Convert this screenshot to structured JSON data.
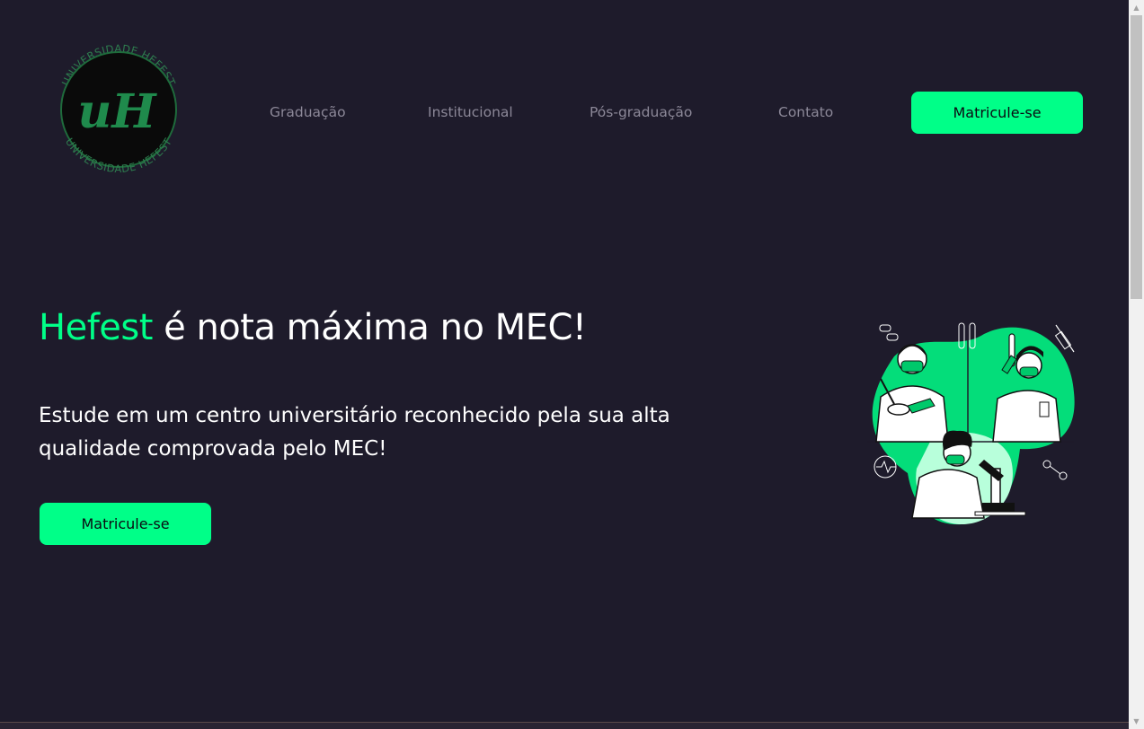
{
  "logo": {
    "ring_text_top": "UNIVERSIDADE HEFEST",
    "ring_text_bottom": "UNIVERSIDADE HEFEST",
    "monogram": "uH"
  },
  "nav": {
    "items": [
      {
        "label": "Graduação"
      },
      {
        "label": "Institucional"
      },
      {
        "label": "Pós-graduação"
      },
      {
        "label": "Contato"
      }
    ],
    "cta_label": "Matricule-se"
  },
  "hero": {
    "title_accent": "Hefest",
    "title_rest": " é nota máxima no MEC!",
    "subtitle": "Estude em um centro universitário reconhecido pela sua alta qualidade comprovada pelo MEC!",
    "cta_label": "Matricule-se"
  },
  "colors": {
    "background": "#1e1b2b",
    "accent": "#00ff88",
    "nav_text": "#8c8898",
    "logo_green": "#2e8b57"
  },
  "icons": {
    "illustration": "scientists-lab-illustration",
    "scroll_up": "scroll-up-arrow-icon",
    "scroll_down": "scroll-down-arrow-icon"
  }
}
